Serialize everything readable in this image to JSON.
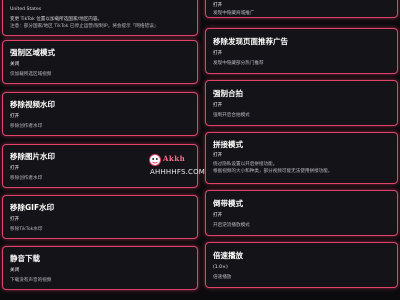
{
  "cards": {
    "region_info": {
      "line1": "United States",
      "line2": "变更 TikTok 位置以加载所选国家/地区内容。",
      "line3": "注意：部分国家/地区 TikTok 已停止运营/限制IP，将会提示「网络错误」"
    },
    "force_region": {
      "title": "强制区域模式",
      "status": "关闭",
      "desc": "仅加载所选区域视频"
    },
    "remove_watermark": {
      "title": "移除视频水印",
      "status": "打开",
      "desc": "移除创作者水印"
    },
    "remove_photo_watermark": {
      "title": "移除图片水印",
      "status": "打开",
      "desc": "移除创作者水印"
    },
    "remove_gif_watermark": {
      "title": "移除GIF水印",
      "status": "打开",
      "desc": "移除TikTok水印"
    },
    "silent_download": {
      "title": "静音下载",
      "status": "关闭",
      "desc": "下载没有声音的视频"
    },
    "hide_store": {
      "line1": "打开",
      "line2": "发现中隐藏商城推广"
    },
    "remove_discover_ads": {
      "title": "移除发现页面推荐广告",
      "status": "打开",
      "desc": "发现中隐藏部分热门推荐"
    },
    "force_collab": {
      "title": "强制合拍",
      "status": "打开",
      "desc": "强制开启合拍模式"
    },
    "stitch_mode": {
      "title": "拼接模式",
      "status": "打开",
      "desc1": "绕过隐私设置以开启拼接功能。",
      "desc2": "根据视频的大小和种类，部分视频可能无法使用拼接功能。"
    },
    "reverse_mode": {
      "title": "倒带模式",
      "status": "打开",
      "desc": "开启逆流播放模式"
    },
    "speed_play": {
      "title": "倍速播放",
      "status": "(1.0×)",
      "desc": "倍速播放"
    }
  },
  "watermark": {
    "brand": "Akkh",
    "url": "AHHHHFS.COM"
  },
  "colors": {
    "card_border": "#e0426a",
    "background": "#0b0b0e",
    "card_bg": "#141418"
  }
}
